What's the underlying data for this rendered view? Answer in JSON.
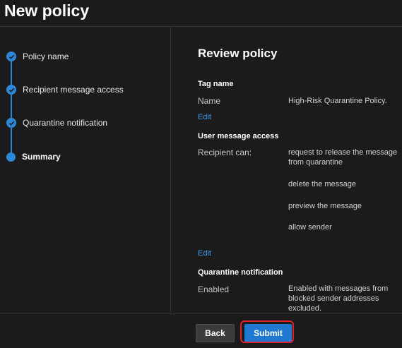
{
  "header": {
    "title": "New policy"
  },
  "steps": [
    {
      "label": "Policy name",
      "state": "done"
    },
    {
      "label": "Recipient message access",
      "state": "done"
    },
    {
      "label": "Quarantine notification",
      "state": "done"
    },
    {
      "label": "Summary",
      "state": "current"
    }
  ],
  "review": {
    "title": "Review policy",
    "tag_section": {
      "heading": "Tag name",
      "key": "Name",
      "value": "High-Risk Quarantine Policy.",
      "edit": "Edit"
    },
    "access_section": {
      "heading": "User message access",
      "key": "Recipient can:",
      "values": [
        "request to release the message from quarantine",
        "delete the message",
        "preview the message",
        "allow sender"
      ],
      "edit": "Edit"
    },
    "notification_section": {
      "heading": "Quarantine notification",
      "key": "Enabled",
      "value": "Enabled with messages from blocked sender addresses excluded."
    }
  },
  "footer": {
    "back_label": "Back",
    "submit_label": "Submit"
  },
  "colors": {
    "accent": "#2b88d8",
    "highlight": "#e0202a",
    "link": "#3f9ae6"
  }
}
